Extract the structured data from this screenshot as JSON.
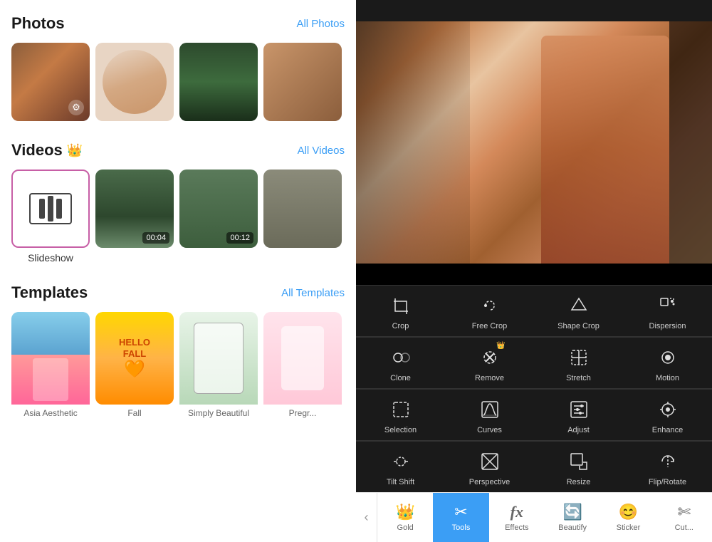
{
  "left": {
    "sections": {
      "photos": {
        "title": "Photos",
        "all_link": "All Photos",
        "thumbnails": [
          {
            "id": "photo-1",
            "type": "rock"
          },
          {
            "id": "photo-2",
            "type": "portrait"
          },
          {
            "id": "photo-3",
            "type": "forest"
          },
          {
            "id": "photo-4",
            "type": "rock2"
          }
        ]
      },
      "videos": {
        "title": "Videos",
        "all_link": "All Videos",
        "crown": true,
        "items": [
          {
            "id": "video-slideshow",
            "label": "Slideshow",
            "type": "slideshow"
          },
          {
            "id": "video-1",
            "duration": "00:04",
            "type": "forest1"
          },
          {
            "id": "video-2",
            "duration": "00:12",
            "type": "forest2"
          },
          {
            "id": "video-3",
            "type": "mountain"
          }
        ]
      },
      "templates": {
        "title": "Templates",
        "all_link": "All Templates",
        "items": [
          {
            "id": "tmpl-asia",
            "label": "Asia Aesthetic",
            "type": "asia"
          },
          {
            "id": "tmpl-fall",
            "label": "Fall",
            "type": "fall"
          },
          {
            "id": "tmpl-simply",
            "label": "Simply Beautiful",
            "type": "simply"
          },
          {
            "id": "tmpl-preg",
            "label": "Pregr...",
            "type": "preg"
          }
        ]
      }
    }
  },
  "right": {
    "tools_rows": [
      [
        {
          "id": "crop",
          "label": "Crop",
          "icon": "crop"
        },
        {
          "id": "free-crop",
          "label": "Free Crop",
          "icon": "free-crop"
        },
        {
          "id": "shape-crop",
          "label": "Shape Crop",
          "icon": "shape-crop"
        },
        {
          "id": "dispersion",
          "label": "Dispersion",
          "icon": "dispersion"
        }
      ],
      [
        {
          "id": "clone",
          "label": "Clone",
          "icon": "clone"
        },
        {
          "id": "remove",
          "label": "Remove",
          "icon": "remove",
          "crown": true
        },
        {
          "id": "stretch",
          "label": "Stretch",
          "icon": "stretch"
        },
        {
          "id": "motion",
          "label": "Motion",
          "icon": "motion"
        }
      ],
      [
        {
          "id": "selection",
          "label": "Selection",
          "icon": "selection"
        },
        {
          "id": "curves",
          "label": "Curves",
          "icon": "curves"
        },
        {
          "id": "adjust",
          "label": "Adjust",
          "icon": "adjust"
        },
        {
          "id": "enhance",
          "label": "Enhance",
          "icon": "enhance"
        }
      ],
      [
        {
          "id": "tilt-shift",
          "label": "Tilt Shift",
          "icon": "tilt-shift"
        },
        {
          "id": "perspective",
          "label": "Perspective",
          "icon": "perspective"
        },
        {
          "id": "resize",
          "label": "Resize",
          "icon": "resize"
        },
        {
          "id": "flip-rotate",
          "label": "Flip/Rotate",
          "icon": "flip-rotate"
        }
      ]
    ],
    "bottom_nav": [
      {
        "id": "gold",
        "label": "Gold",
        "icon": "crown"
      },
      {
        "id": "tools",
        "label": "Tools",
        "icon": "tools",
        "active": true
      },
      {
        "id": "effects",
        "label": "Effects",
        "icon": "fx"
      },
      {
        "id": "beautify",
        "label": "Beautify",
        "icon": "face"
      },
      {
        "id": "sticker",
        "label": "Sticker",
        "icon": "sticker"
      },
      {
        "id": "cut",
        "label": "Cut...",
        "icon": "cut"
      }
    ]
  }
}
